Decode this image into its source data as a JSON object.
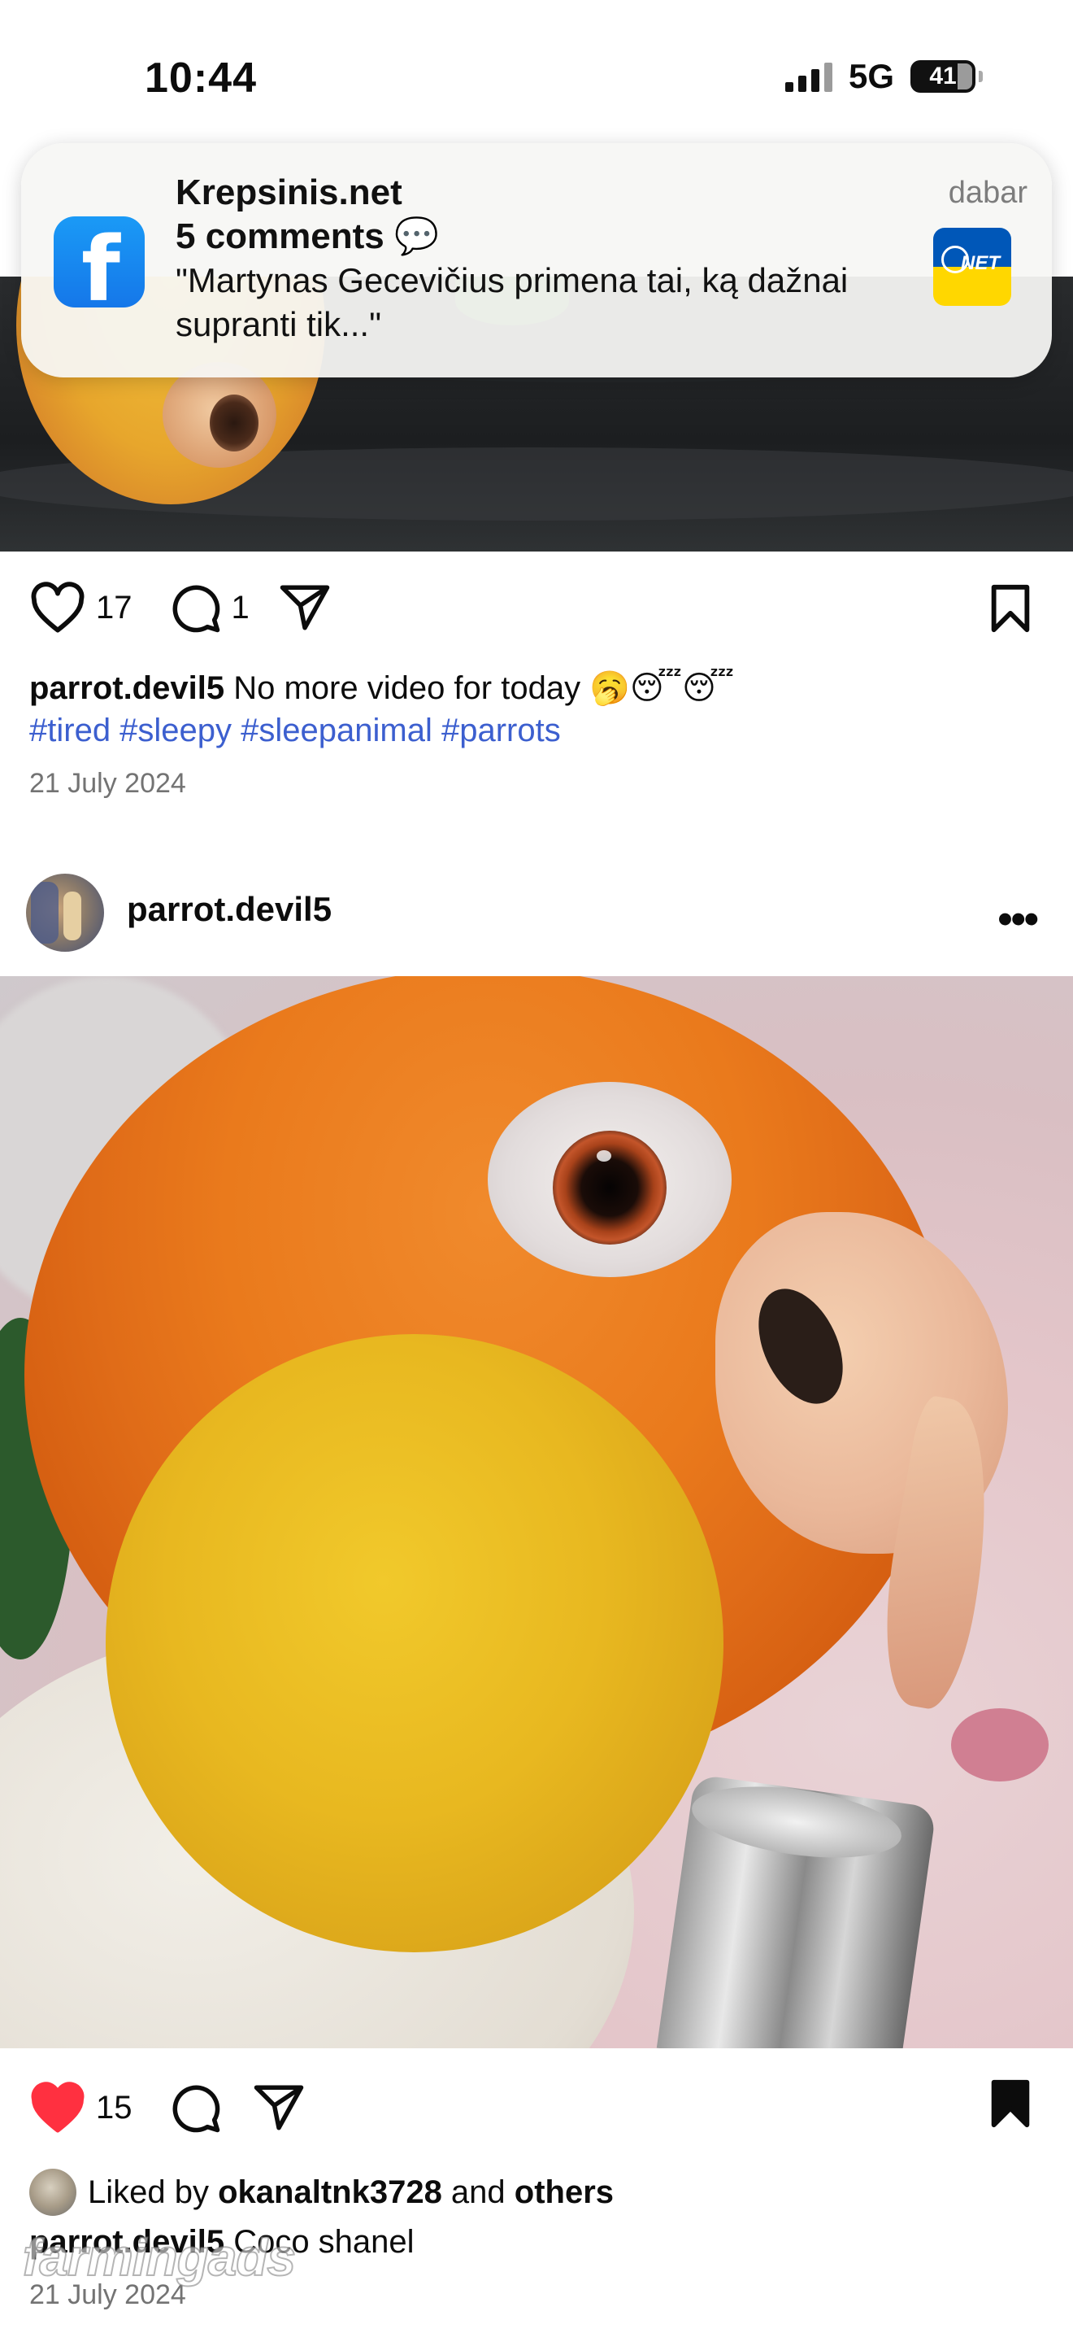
{
  "status_bar": {
    "time": "10:44",
    "network": "5G",
    "battery": "41"
  },
  "notification": {
    "app_title": "Krepsinis.net",
    "subtitle": "5 comments 💬",
    "body": "\"Martynas Gecevičius primena tai, ką dažnai supranti tik...\"",
    "time": "dabar",
    "icon": "facebook-icon",
    "badge_icon": "krepsinis-net-logo"
  },
  "post1": {
    "likes": "17",
    "comments": "1",
    "username": "parrot.devil5",
    "caption": "No more video for today 🥱😴😴",
    "hashtags": "#tired #sleepy #sleepanimal #parrots",
    "date": "21 July 2024"
  },
  "post2": {
    "username": "parrot.devil5",
    "likes": "15",
    "liked_by_prefix": "Liked by ",
    "liked_by_user": "okanaltnk3728",
    "liked_by_and": " and ",
    "liked_by_others": "others",
    "caption_user": "parrot.devil5",
    "caption": " Coco shanel",
    "date": "21 July 2024",
    "liked": true,
    "saved": true
  },
  "watermark": "farmingads",
  "colors": {
    "hashtag": "#3c5fcf",
    "like_red": "#ff3040",
    "facebook_blue": "#1877f2",
    "muted": "#737373"
  }
}
